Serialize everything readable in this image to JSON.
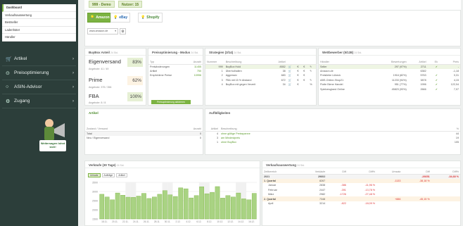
{
  "sidebar": {
    "subnav": [
      "Dashboard",
      "Verkaufsauswertung",
      "Bestseller",
      "Ladenhüter",
      "Händler"
    ],
    "nav": [
      {
        "label": "Artikel",
        "icon": "cart-icon",
        "glyph": "🛒"
      },
      {
        "label": "Preisoptimierung",
        "icon": "pin-icon",
        "glyph": "⊙"
      },
      {
        "label": "ASIN-Advisor",
        "icon": "circle-icon",
        "glyph": "○"
      },
      {
        "label": "Zugang",
        "icon": "gear-icon",
        "glyph": "⚙"
      }
    ],
    "promo": "Weitersagen lohnt sich!"
  },
  "topbar": {
    "demo": "999 - Demo",
    "nutzer": "Nutzer: 15"
  },
  "marketplaces": [
    {
      "label": "Amazon",
      "selected": true
    },
    {
      "label": "eBay",
      "selected": false
    },
    {
      "label": "Shopify",
      "selected": false
    }
  ],
  "domain_select": "www.amazon.de",
  "buybox": {
    "title": "BuyBox Anteil",
    "sub": "24 Std.",
    "items": [
      {
        "label": "Eigenversand",
        "pct": "83%",
        "sub": "Angebote: 41 / 49"
      },
      {
        "label": "Prime",
        "pct": "62%",
        "sub": "Angebote: 375 / 356"
      },
      {
        "label": "FBA",
        "pct": "100%",
        "sub": "Angebote: 8 / 8"
      }
    ]
  },
  "preisopt": {
    "title": "Preisoptimierung - Modus",
    "sub": "24 Std.",
    "headers": [
      "Typ",
      "Anzahl"
    ],
    "rows": [
      [
        "Preisänderungen",
        "11455"
      ],
      [
        "Artikel",
        "750"
      ],
      [
        "Empfohlene Preise",
        "10996"
      ]
    ],
    "button": "Preisoptimierung aktivieren"
  },
  "strategien": {
    "title": "Strategien (3/14)",
    "sub": "24 Std.",
    "headers": [
      "Nummer",
      "Beschreibung",
      "Artikel"
    ],
    "rows": [
      [
        "999",
        "BuyBox Hold",
        "8552"
      ],
      [
        "1",
        "Überholhalten",
        "38"
      ],
      [
        "2",
        "Aggressiv",
        "683"
      ],
      [
        "3",
        "FBA mit 15 % Abstand",
        "672"
      ],
      [
        "4",
        "BuyBox mit gegen Verzeit",
        "34"
      ]
    ]
  },
  "wettbewerber": {
    "title": "Wettbewerber (5/138)",
    "sub": "24 Std.",
    "headers": [
      "Händler",
      "Bewertungen",
      "Artikel",
      "Ek",
      "Preis"
    ],
    "rows": [
      [
        "Seller",
        "297 (97%)",
        "2711",
        "",
        "-"
      ],
      [
        "Amazon.de",
        "",
        "6382",
        "",
        "-1,18"
      ],
      [
        "Preisliebe Lübeck",
        "1916 (82%)",
        "5763",
        "",
        "0,31"
      ],
      [
        "ABS-Online-Shop21",
        "11233 (94%)",
        "3878",
        "",
        "4,15"
      ],
      [
        "Flotte Biene Handel",
        "951 (77%)",
        "1996",
        "",
        "122,04"
      ],
      [
        "Spielzeugland Online",
        "45823 (93%)",
        "2666",
        "",
        "7,07"
      ]
    ]
  },
  "artikel": {
    "title": "Artikel",
    "headers": [
      "Zustand / Versand",
      "Anzahl"
    ],
    "rows": [
      [
        "Total",
        "0"
      ],
      [
        "Neu / Eigenversand",
        "0"
      ]
    ]
  },
  "auff": {
    "title": "Auffälligkeiten",
    "headers": [
      "Artikel",
      "Beschreibung",
      "%"
    ],
    "rows": [
      [
        "4",
        "ohne gültige Preisspanne",
        "44"
      ],
      [
        "3",
        "am Mindestpreis",
        "19"
      ],
      [
        "1",
        "ohne BuyBox",
        "105"
      ]
    ]
  },
  "chart_data": {
    "type": "bar",
    "title": "Verkäufe (30 Tage)",
    "subtitle": "24 Std.",
    "legend": [
      "Umsatz",
      "Aufträge",
      "Artikel"
    ],
    "yticks": [
      "3500",
      "3000",
      "2500",
      "2000",
      "1500"
    ],
    "ylim": [
      1500,
      3500
    ],
    "xticks": [
      "18.11.",
      "20.11.",
      "22.11.",
      "24.11.",
      "26.11.",
      "28.11.",
      "30.11.",
      "2.12.",
      "4.12.",
      "6.12.",
      "8.12.",
      "10.12.",
      "12.12.",
      "14.12.",
      "16.12."
    ],
    "values": [
      2850,
      2700,
      2550,
      2920,
      2800,
      2690,
      2680,
      2750,
      2900,
      2620,
      2700,
      2850,
      3050,
      2820,
      2730,
      3200,
      3150,
      2650,
      2780,
      3260,
      2880,
      2950,
      3270,
      2640,
      2780,
      2700,
      2920,
      2600,
      2550,
      2900
    ]
  },
  "verkauf": {
    "title": "Verkaufsauswertung",
    "sub": "24 Std.",
    "headers": [
      "Zeitbereich",
      "Verkäufe",
      "Diff",
      "Diff%",
      "Umsatz",
      "Diff",
      "Diff%"
    ],
    "rows": [
      [
        "2021",
        "29602",
        "",
        "",
        "",
        "-26651",
        "-34,68 %"
      ],
      [
        "1. Quartal",
        "8267",
        "",
        "",
        "-1133",
        "-38,18 %",
        ""
      ],
      [
        "Januar",
        "2838",
        "-386",
        "-11,96 %",
        "",
        "",
        ""
      ],
      [
        "Februar",
        "2447",
        "-391",
        "-13,78 %",
        "",
        "",
        ""
      ],
      [
        "März",
        "2982",
        "-1726",
        "-27,48 %",
        "",
        "",
        ""
      ],
      [
        "2. Quartal",
        "7348",
        "",
        "",
        "+886",
        "-45,15 %",
        ""
      ],
      [
        "April",
        "3214",
        "-822",
        "-18,09 %",
        "",
        "",
        ""
      ]
    ]
  }
}
